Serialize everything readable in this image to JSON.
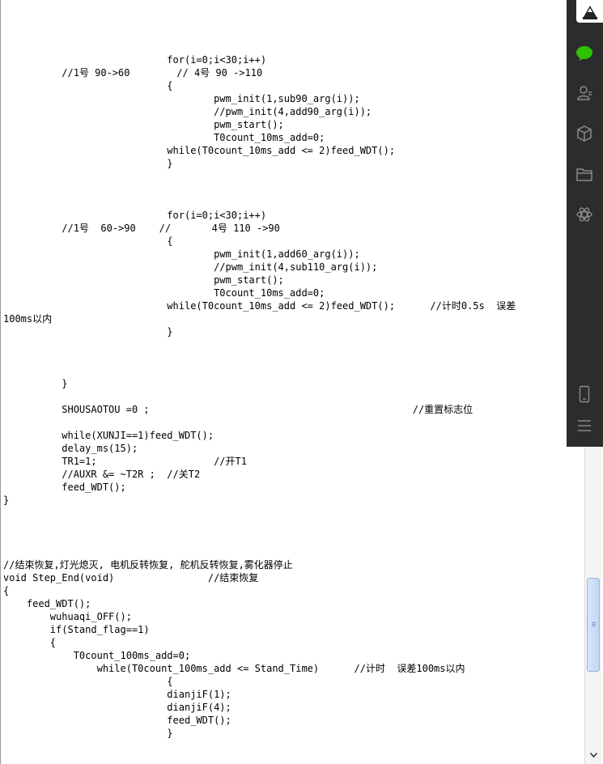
{
  "code_lines": [
    "                            for(i=0;i<30;i++)",
    "          //1号 90->60        // 4号 90 ->110",
    "                            {",
    "                                    pwm_init(1,sub90_arg(i));",
    "                                    //pwm_init(4,add90_arg(i));",
    "                                    pwm_start();",
    "                                    T0count_10ms_add=0;",
    "                            while(T0count_10ms_add <= 2)feed_WDT();",
    "                            }",
    "",
    "",
    "",
    "                            for(i=0;i<30;i++)",
    "          //1号  60->90    //       4号 110 ->90",
    "                            {",
    "                                    pwm_init(1,add60_arg(i));",
    "                                    //pwm_init(4,sub110_arg(i));",
    "                                    pwm_start();",
    "                                    T0count_10ms_add=0;",
    "                            while(T0count_10ms_add <= 2)feed_WDT();      //计时0.5s  误差",
    "100ms以内",
    "                            }",
    "",
    "",
    "",
    "          }",
    "",
    "          SHOUSAOTOU =0 ;                                             //重置标志位",
    "",
    "          while(XUNJI==1)feed_WDT();",
    "          delay_ms(15);",
    "          TR1=1;                    //开T1",
    "          //AUXR &= ~T2R ;  //关T2",
    "          feed_WDT();",
    "}",
    "",
    "",
    "",
    "",
    "//结束恢复,灯光熄灭, 电机反转恢复, 舵机反转恢复,雾化器停止",
    "void Step_End(void)                //结束恢复",
    "{",
    "    feed_WDT();",
    "        wuhuaqi_OFF();",
    "        if(Stand_flag==1)",
    "        {",
    "            T0count_100ms_add=0;",
    "                while(T0count_100ms_add <= Stand_Time)      //计时  误差100ms以内",
    "                            {",
    "                            dianjiF(1);",
    "                            dianjiF(4);",
    "                            feed_WDT();",
    "                            }"
  ],
  "sidebar": {
    "icons": [
      "app-logo-icon",
      "chat-icon",
      "contacts-icon",
      "box-icon",
      "folder-icon",
      "settings-icon",
      "phone-icon",
      "menu-icon"
    ],
    "accent_color": "#2dc100",
    "background": "#2c2c2c"
  }
}
